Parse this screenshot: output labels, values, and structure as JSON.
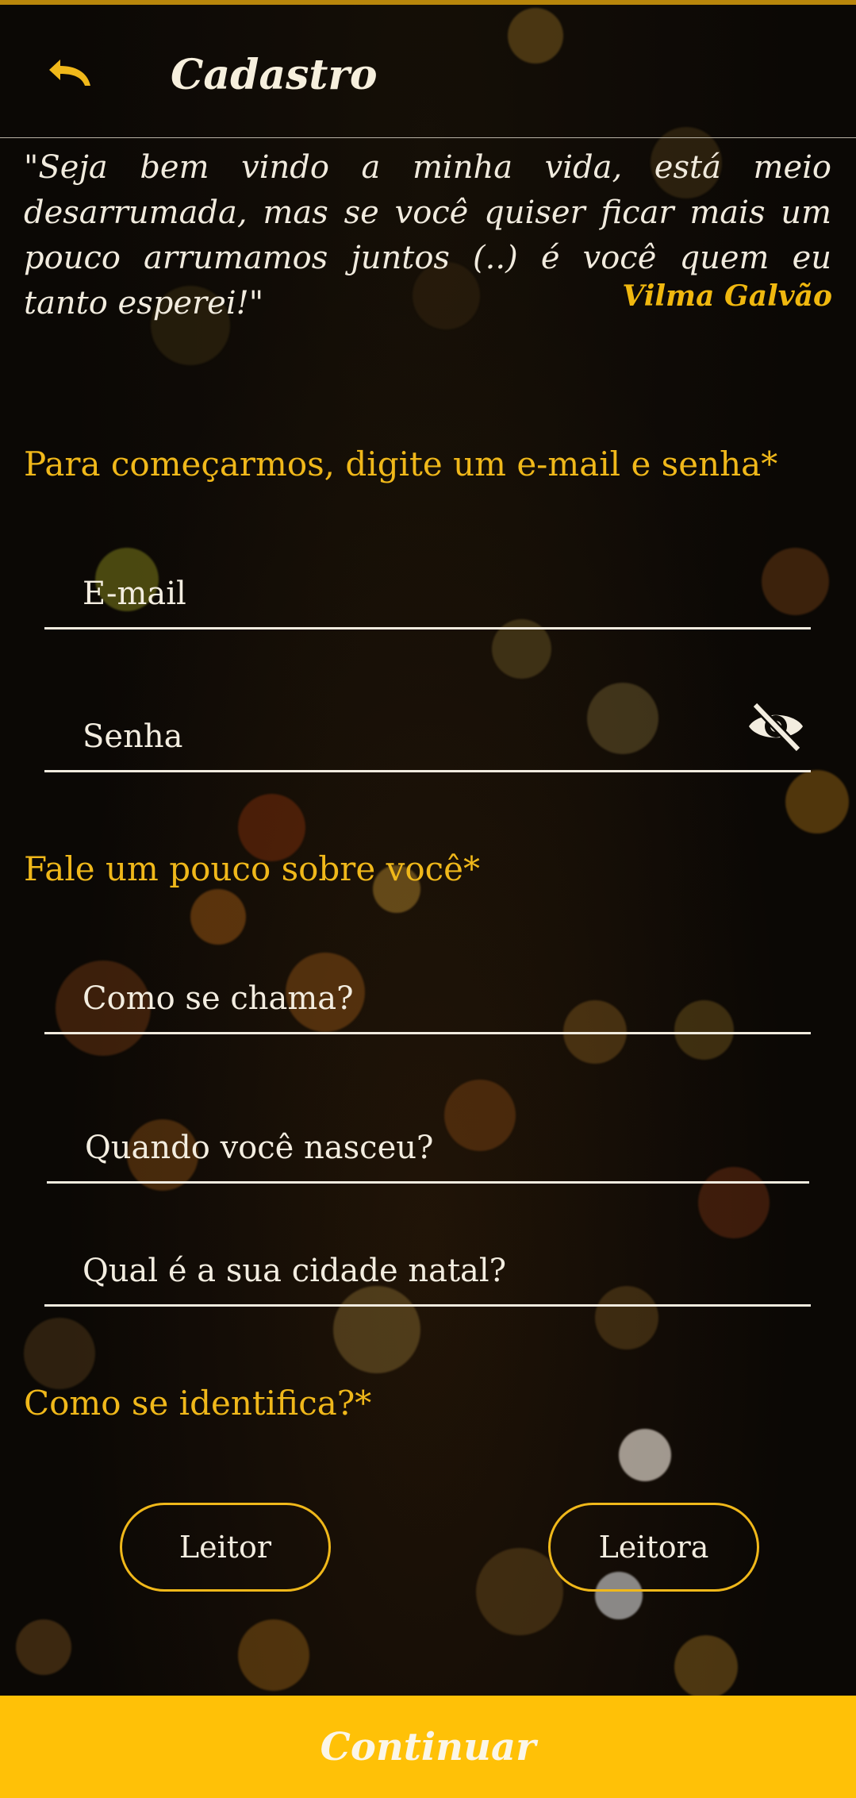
{
  "header": {
    "title": "Cadastro",
    "back_icon": "undo-arrow-icon"
  },
  "quote": {
    "text": "\"Seja bem vindo a minha vida, está meio desarrumada, mas se você quiser ficar mais um pouco arrumamos juntos (..) é você quem eu tanto esperei!\"",
    "author": "Vilma Galvão"
  },
  "sections": {
    "credentials": "Para começarmos, digite um e-mail e senha*",
    "about": "Fale um pouco sobre você*",
    "identity": "Como se identifica?*"
  },
  "fields": {
    "email": {
      "placeholder": "E-mail",
      "value": ""
    },
    "password": {
      "placeholder": "Senha",
      "value": "",
      "toggle_icon": "eye-off-icon"
    },
    "name": {
      "placeholder": "Como se chama?",
      "value": ""
    },
    "birth": {
      "placeholder": "Quando você nasceu?",
      "value": ""
    },
    "city": {
      "placeholder": "Qual é a sua cidade natal?",
      "value": ""
    }
  },
  "gender_options": {
    "option1": "Leitor",
    "option2": "Leitora"
  },
  "continue_label": "Continuar",
  "colors": {
    "accent": "#F0B81A",
    "button": "#FFC107",
    "background": "#0B0805",
    "text": "#F3EDE0"
  }
}
